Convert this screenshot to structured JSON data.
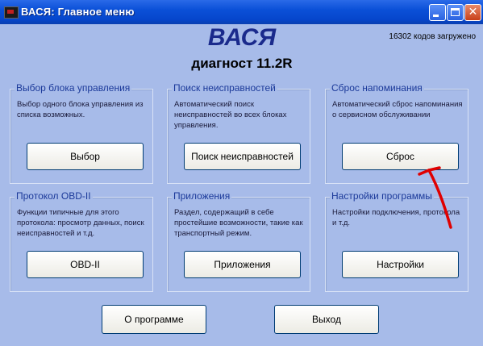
{
  "window": {
    "title": "ВАСЯ: Главное меню",
    "close_glyph": "✕"
  },
  "header": {
    "app_name": "ВАСЯ",
    "version": "диагност 11.2R",
    "codes_loaded": "16302 кодов загружено"
  },
  "groups": [
    {
      "title": "Выбор блока управления",
      "desc": "Выбор одного блока управления из списка возможных.",
      "button": "Выбор"
    },
    {
      "title": "Поиск неисправностей",
      "desc": "Автоматический поиск неисправностей во всех блоках управления.",
      "button": "Поиск неисправностей"
    },
    {
      "title": "Сброс напоминания",
      "desc": "Автоматический сброс напоминания о сервисном обслуживании",
      "button": "Сброс"
    },
    {
      "title": "Протокол OBD-II",
      "desc": "Функции типичные для этого протокола: просмотр данных, поиск неисправностей и т.д.",
      "button": "OBD-II"
    },
    {
      "title": "Приложения",
      "desc": "Раздел, содержащий в себе простейшие возможности, такие как транспортный режим.",
      "button": "Приложения"
    },
    {
      "title": "Настройки программы",
      "desc": "Настройки подключения, протокола и т.д.",
      "button": "Настройки"
    }
  ],
  "footer": {
    "about": "О программе",
    "exit": "Выход"
  },
  "annotation": {
    "arrow_color": "#e00000"
  }
}
